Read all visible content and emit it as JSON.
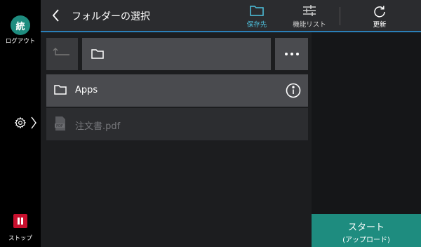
{
  "rail": {
    "avatar_char": "統",
    "logout_label": "ログアウト",
    "stop_label": "ストップ"
  },
  "header": {
    "title": "フォルダーの選択",
    "tools": {
      "save_label": "保存先",
      "function_list_label": "機能リスト",
      "refresh_label": "更新"
    }
  },
  "path": {
    "current": ""
  },
  "items": [
    {
      "name": "Apps",
      "type": "folder",
      "enabled": true
    },
    {
      "name": "注文書.pdf",
      "type": "pdf",
      "enabled": false
    }
  ],
  "start": {
    "label": "スタート",
    "sub_label": "(アップロード)"
  },
  "colors": {
    "accent_teal": "#1e8c7f",
    "selected_tool": "#4ec3e0",
    "stop_red": "#c8102e",
    "header_line": "#2a7fb8"
  }
}
